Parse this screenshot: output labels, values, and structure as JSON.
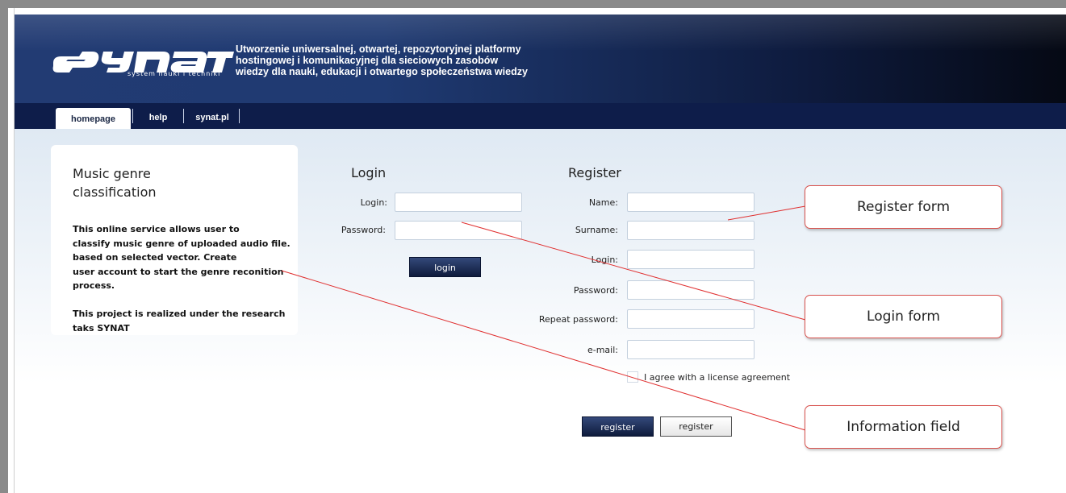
{
  "header": {
    "logo_subtext": "system nauki i techniki",
    "tagline": [
      "Utworzenie uniwersalnej, otwartej, repozytoryjnej platformy",
      "hostingowej i komunikacyjnej dla sieciowych zasobów",
      "wiedzy dla nauki, edukacji i otwartego społeczeństwa wiedzy"
    ]
  },
  "nav": {
    "tabs": [
      {
        "label": "homepage"
      },
      {
        "label": "help"
      },
      {
        "label": "synat.pl"
      }
    ]
  },
  "info": {
    "title": "Music genre\nclassification",
    "text": "This online service allows user to\nclassify music genre of uploaded audio file.\nbased on selected  vector. Create\nuser account to start the genre reconition\nprocess.\n\nThis project is realized under the research\ntaks SYNAT"
  },
  "login": {
    "title": "Login",
    "login_label": "Login:",
    "password_label": "Password:",
    "button": "login"
  },
  "register": {
    "title": "Register",
    "name_label": "Name:",
    "surname_label": "Surname:",
    "login_label": "Login:",
    "password_label": "Password:",
    "repeat_password_label": "Repeat password:",
    "email_label": "e-mail:",
    "agree_label": "I agree with a license agreement",
    "button_primary": "register",
    "button_secondary": "register"
  },
  "callouts": {
    "register_form": "Register form",
    "login_form": "Login form",
    "information_field": "Information field"
  },
  "colors": {
    "header_dark": "#0e1b3e",
    "nav_bg": "#0e1d4a",
    "callout_border": "#d9534f"
  }
}
